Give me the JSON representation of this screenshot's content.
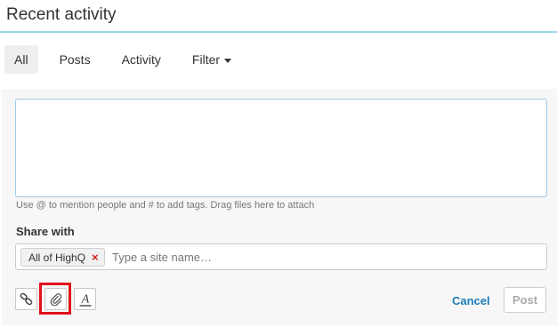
{
  "header": {
    "title": "Recent activity"
  },
  "tabs": [
    {
      "label": "All",
      "active": true
    },
    {
      "label": "Posts",
      "active": false
    },
    {
      "label": "Activity",
      "active": false
    },
    {
      "label": "Filter",
      "active": false,
      "has_dropdown": true
    }
  ],
  "composer": {
    "value": "",
    "hint": "Use @ to mention people and # to add tags. Drag files here to attach"
  },
  "share": {
    "label": "Share with",
    "chip_label": "All of HighQ",
    "chip_remove_glyph": "×",
    "site_placeholder": "Type a site name…"
  },
  "toolbar": {
    "buttons": [
      {
        "icon": "link-icon"
      },
      {
        "icon": "paperclip-icon",
        "highlighted": true
      },
      {
        "icon": "text-format-icon",
        "glyph": "A"
      }
    ],
    "cancel_label": "Cancel",
    "post_label": "Post"
  },
  "colors": {
    "accent_rule": "#9ed8ec",
    "link_blue": "#1a7db8",
    "remove_red": "#cc2222",
    "highlight_red": "#e0121b",
    "panel_bg": "#f7f7f7"
  }
}
